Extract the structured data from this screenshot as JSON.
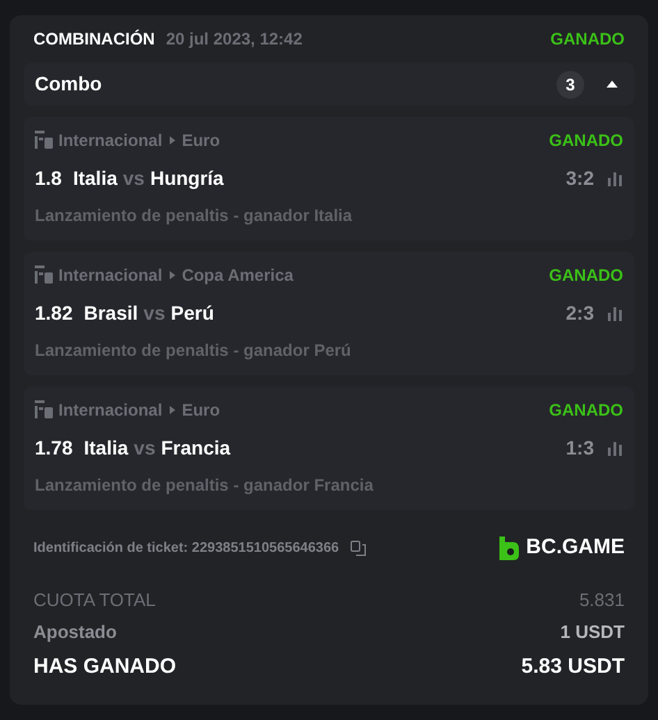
{
  "header": {
    "type": "COMBINACIÓN",
    "date": "20 jul 2023, 12:42",
    "status": "GANADO",
    "won": true
  },
  "combo": {
    "label": "Combo",
    "count": "3",
    "expanded": true
  },
  "bets": [
    {
      "category": "Internacional",
      "league": "Euro",
      "status": "GANADO",
      "won": true,
      "odds": "1.8",
      "home": "Italia",
      "vs": "vs",
      "away": "Hungría",
      "score": "3:2",
      "market": "Lanzamiento de penaltis - ganador Italia"
    },
    {
      "category": "Internacional",
      "league": "Copa America",
      "status": "GANADO",
      "won": true,
      "odds": "1.82",
      "home": "Brasil",
      "vs": "vs",
      "away": "Perú",
      "score": "2:3",
      "market": "Lanzamiento de penaltis - ganador Perú"
    },
    {
      "category": "Internacional",
      "league": "Euro",
      "status": "GANADO",
      "won": true,
      "odds": "1.78",
      "home": "Italia",
      "vs": "vs",
      "away": "Francia",
      "score": "1:3",
      "market": "Lanzamiento de penaltis - ganador Francia"
    }
  ],
  "ticket": {
    "label": "Identificación de ticket: 2293851510565646366",
    "brand": "BC.GAME"
  },
  "summary": [
    {
      "kind": "muted",
      "label": "CUOTA TOTAL",
      "value": "5.831"
    },
    {
      "kind": "normal",
      "label": "Apostado",
      "value": "1 USDT"
    },
    {
      "kind": "strong",
      "label": "HAS GANADO",
      "value": "5.83 USDT"
    }
  ]
}
